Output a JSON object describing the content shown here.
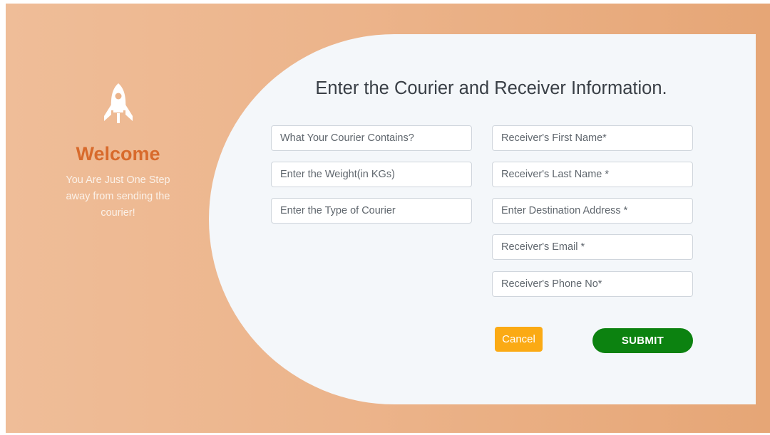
{
  "welcome": {
    "icon": "rocket-icon",
    "title": "Welcome",
    "line1": "You Are Just One Step",
    "line2": "away from sending the",
    "line3": "courier!"
  },
  "form": {
    "title": "Enter the Courier and Receiver Information.",
    "courier_fields": [
      {
        "placeholder": "What Your Courier Contains?",
        "value": ""
      },
      {
        "placeholder": "Enter the Weight(in KGs)",
        "value": ""
      },
      {
        "placeholder": "Enter the Type of Courier",
        "value": ""
      }
    ],
    "receiver_fields": [
      {
        "placeholder": "Receiver's First Name*",
        "value": ""
      },
      {
        "placeholder": "Receiver's Last Name *",
        "value": ""
      },
      {
        "placeholder": "Enter Destination Address *",
        "value": ""
      },
      {
        "placeholder": "Receiver's Email *",
        "value": ""
      },
      {
        "placeholder": "Receiver's Phone No*",
        "value": ""
      }
    ],
    "cancel_label": "Cancel",
    "submit_label": "SUBMIT"
  },
  "colors": {
    "background_gradient": [
      "#efbd98",
      "#e6a676"
    ],
    "welcome_title": "#d86a2c",
    "card": "#f4f7fa",
    "cancel": "#fbaa14",
    "submit": "#0c8210"
  }
}
